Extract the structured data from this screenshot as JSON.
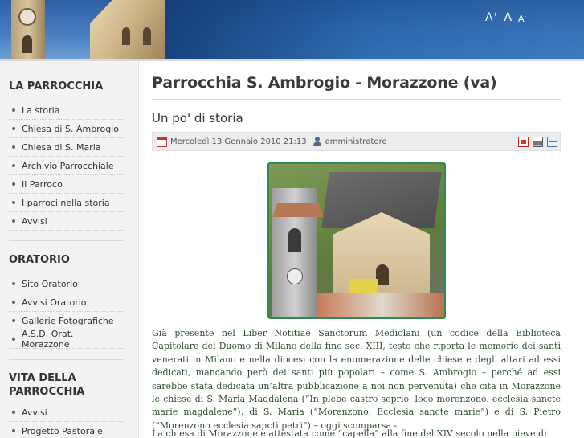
{
  "header": {
    "font_increase": "A",
    "font_reset": "A",
    "font_decrease": "A",
    "font_increase_sup": "+",
    "font_decrease_sup": "-"
  },
  "sidebar": {
    "sections": [
      {
        "heading": "LA PARROCCHIA",
        "items": [
          "La storia",
          "Chiesa di S. Ambrogio",
          "Chiesa di S. Maria",
          "Archivio Parrocchiale",
          "Il Parroco",
          "I parroci nella storia",
          "Avvisi"
        ]
      },
      {
        "heading": "ORATORIO",
        "items": [
          "Sito Oratorio",
          "Avvisi Oratorio",
          "Gallerie Fotografiche",
          "A.S.D. Orat. Morazzone"
        ]
      },
      {
        "heading_line1": "VITA DELLA",
        "heading_line2": "PARROCCHIA",
        "items": [
          "Avvisi",
          "Progetto Pastorale"
        ]
      }
    ]
  },
  "main": {
    "page_title": "Parrocchia S. Ambrogio - Morazzone (va)",
    "article_title": "Un po' di storia",
    "meta": {
      "date": "Mercoledì 13 Gennaio 2010 21:13",
      "author": "amministratore"
    },
    "paragraph1": "Già presente nel Liber Notitiae Sanctorum Mediolani (un codice della Biblioteca Capitolare del Duomo di Milano della fine sec. XIII, testo che riporta le memorie dei santi venerati in Milano e nella diocesi con la enumerazione delle chiese e degli altari ad essi dedicati, mancando però dei santi più popolari – come S. Ambrogio – perché ad essi sarebbe stata dedicata un’altra pubblicazione a noi non pervenuta) che cita in Morazzone le chiese di S. Maria Maddalena (“In plebe castro seprio. loco morenzono. ecclesia sancte marie magdalene”), di S. Maria (“Morenzono. Ecclesia sancte marie”) e di S. Pietro (“Morenzono ecclesia sancti petri”) – oggi scomparsa -.",
    "paragraph2": "La chiesa di Morazzone è attestata come “capella” alla fine del XIV secolo nella pieve di"
  },
  "colors": {
    "header_blue": "#2f6aaa",
    "sidebar_bg": "#f3f3f3",
    "body_text": "#2f4f2f",
    "photo_border": "#2e8b57"
  }
}
